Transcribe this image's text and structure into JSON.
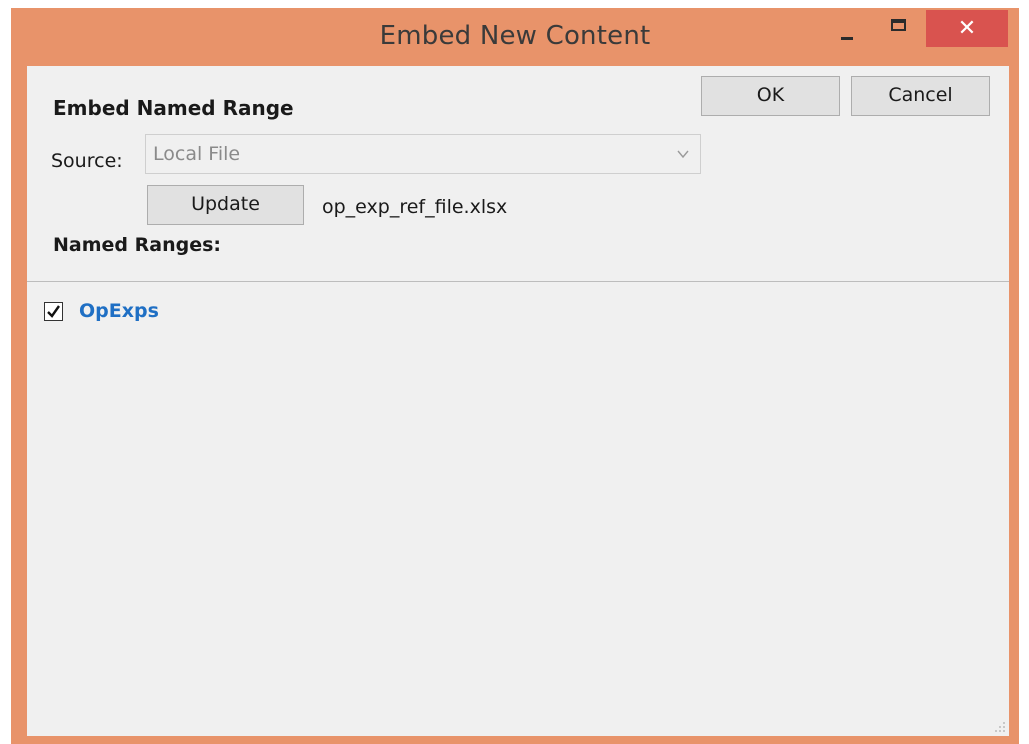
{
  "window": {
    "title": "Embed New Content",
    "controls": {
      "minimize": "minimize",
      "maximize": "maximize",
      "close": "close"
    }
  },
  "toolbar": {
    "ok_label": "OK",
    "cancel_label": "Cancel"
  },
  "header": {
    "heading": "Embed Named Range",
    "source_label": "Source:",
    "source_value": "Local File",
    "update_label": "Update",
    "file_name": "op_exp_ref_file.xlsx",
    "ranges_label": "Named Ranges:"
  },
  "named_ranges": [
    {
      "label": "OpExps",
      "checked": true
    }
  ],
  "colors": {
    "title_bar": "#e8936a",
    "close_button": "#d9534f",
    "link_text": "#1f6fc4",
    "panel_background": "#f0f0f0"
  },
  "icons": {
    "minimize": "minimize-icon",
    "maximize": "maximize-icon",
    "close": "close-icon",
    "dropdown": "chevron-down-icon",
    "check": "checkmark-icon",
    "grip": "resize-grip-icon"
  }
}
